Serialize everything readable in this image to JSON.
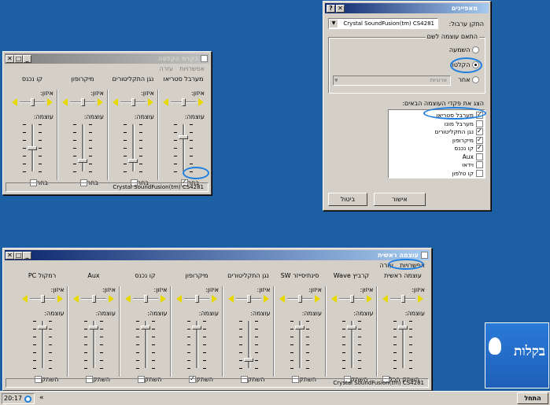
{
  "properties": {
    "title": "מאפיינים",
    "device_label": "התקן ערבול:",
    "device_value": "Crystal SoundFusion(tm) CS4281",
    "adjust_group": "התאם עוצמה לשם",
    "radio_playback": "השמעה",
    "radio_recording": "הקלטה",
    "radio_other": "אחר",
    "other_value": "ארוניות",
    "show_controls": "הצג את פקדי העוצמה הבאים:",
    "controls": [
      {
        "label": "מערבל סטריאו",
        "checked": true
      },
      {
        "label": "מערבל מונו",
        "checked": false
      },
      {
        "label": "נגן התקליטורים",
        "checked": true
      },
      {
        "label": "מיקרופון",
        "checked": true
      },
      {
        "label": "קו נכנס",
        "checked": true
      },
      {
        "label": "Aux",
        "checked": false
      },
      {
        "label": "וידאו",
        "checked": false
      },
      {
        "label": "קו טלפון",
        "checked": false
      }
    ],
    "ok": "אישור",
    "cancel": "ביטול"
  },
  "recording": {
    "title": "בקרת הקלטה",
    "menu": [
      "אפשרויות",
      "עזרה"
    ],
    "strips": [
      {
        "name": "מערבל סטריאו",
        "balance": "איזון:",
        "volume": "עוצמה:",
        "select": "בחר",
        "checked": true,
        "level": 0.75
      },
      {
        "name": "נגן התקליטורים",
        "balance": "איזון:",
        "volume": "עוצמה:",
        "select": "בחר",
        "checked": false,
        "level": 0.2
      },
      {
        "name": "מיקרופון",
        "balance": "איזון:",
        "volume": "עוצמה:",
        "select": "בחר",
        "checked": false,
        "level": 0.2
      },
      {
        "name": "קו נכנס",
        "balance": "איזון:",
        "volume": "עוצמה:",
        "select": "בחר",
        "checked": false,
        "level": 0.5
      }
    ],
    "status": "Crystal SoundFusion(tm) CS4281"
  },
  "main": {
    "title": "עוצמה ראשית",
    "menu": [
      "אפשרויות",
      "עזרה"
    ],
    "strips": [
      {
        "name": "עוצמה ראשית",
        "balance": "איזון:",
        "volume": "עוצמה:",
        "mute": "השתק הכל",
        "checked": false,
        "level": 0.9
      },
      {
        "name": "קרביץ Wave",
        "balance": "איזון:",
        "volume": "עוצמה:",
        "mute": "השתק",
        "checked": false,
        "level": 0.9
      },
      {
        "name": "סינתיסייזר SW",
        "balance": "איזון:",
        "volume": "עוצמה:",
        "mute": "השתק",
        "checked": false,
        "level": 0.9
      },
      {
        "name": "נגן התקליטורים",
        "balance": "איזון:",
        "volume": "עוצמה:",
        "mute": "השתק",
        "checked": false,
        "level": 0.15
      },
      {
        "name": "מיקרופון",
        "balance": "איזון:",
        "volume": "עוצמה:",
        "mute": "השתק",
        "checked": true,
        "level": 0.9
      },
      {
        "name": "קו נכנס",
        "balance": "איזון:",
        "volume": "עוצמה:",
        "mute": "השתק",
        "checked": false,
        "level": 0.9
      },
      {
        "name": "Aux",
        "balance": "איזון:",
        "volume": "עוצמה:",
        "mute": "השתק",
        "checked": false,
        "level": 0.9
      },
      {
        "name": "רמקול PC",
        "balance": "איזון:",
        "volume": "עוצמה:",
        "mute": "השתק",
        "checked": false,
        "level": 0.9
      }
    ],
    "status": "Crystal SoundFusion(tm) CS4281"
  },
  "logo_text": "בקלות",
  "taskbar": {
    "start": "התחל",
    "clock": "20:17",
    "chevron": "«"
  },
  "colors": {
    "desktop": "#1d5fa3",
    "title_active": "#0a246a",
    "highlight": "#1e7fe0"
  }
}
